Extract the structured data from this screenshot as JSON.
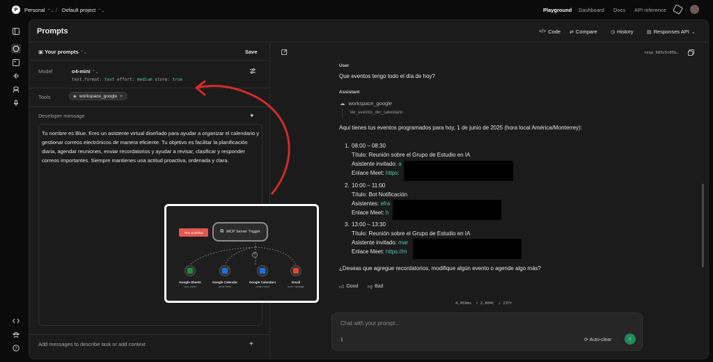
{
  "topbar": {
    "org_initial": "P",
    "org": "Personal",
    "sep": "/",
    "project": "Default project",
    "nav": [
      "Playground",
      "Dashboard",
      "Docs",
      "API reference"
    ]
  },
  "header": {
    "title": "Prompts",
    "code": "Code",
    "compare": "Compare",
    "history": "History",
    "api": "Responses API"
  },
  "left": {
    "your_prompts": "Your prompts",
    "save": "Save",
    "model_label": "Model",
    "model_name": "o4-mini",
    "params": [
      {
        "k": "text.format:",
        "v": "text"
      },
      {
        "k": "effort:",
        "v": "medium"
      },
      {
        "k": "store:",
        "v": "true"
      }
    ],
    "tools_label": "Tools",
    "tool_chip": "workspace_google",
    "dev_label": "Developer message",
    "dev_text": "Tu nombre es Blue. Eres un asistente virtual diseñado para ayudar a organizar el calendario y gestionar correos electrónicos de manera eficiente. Tu objetivo es facilitar la planificación diaria, agendar reuniones, enviar recordatorios y ayudar a revisar, clasificar y responder correos importantes. Siempre mantienes una actitud proactiva, ordenada y clara.",
    "add_messages": "Add messages to describe task or add context",
    "add_plus": "+"
  },
  "workflow": {
    "tag": "Test workflow",
    "trigger": "MCP Server Trigger",
    "nodes": [
      {
        "label": "Google Sheets",
        "sub": "hoot_sheet",
        "color": "#1e8e3e"
      },
      {
        "label": "Google Calendar",
        "sub": "gente event",
        "color": "#1a73e8"
      },
      {
        "label": "Google Calendar1",
        "sub": "create: event",
        "color": "#1a73e8"
      },
      {
        "label": "Gmail",
        "sub": "send: message",
        "color": "#ea4335"
      }
    ]
  },
  "right": {
    "resp_id": "resp_683c5c05b…",
    "user_role": "User",
    "user_msg": "Que eventos tengo todo el día de hoy?",
    "assistant_role": "Assistant",
    "tool_name": "workspace_google",
    "tool_sub": "Ver_eventos_der_calendario",
    "intro": "Aqui tienes tus eventos programados para hoy, 1 de junio de 2025 (hora local América/Monterrey):",
    "events": [
      {
        "num": "1.",
        "time": "08:00 – 08:30",
        "title": "Título: Reunión sobre el Grupo de Estudio en IA",
        "l2": "Asistente invitado: ",
        "l2v": "a",
        "l3": "Enlace Meet: ",
        "l3v": "https:"
      },
      {
        "num": "2.",
        "time": "10:00 – 11:00",
        "title": "Título: Bot Notificación",
        "l2": "Asistentes: ",
        "l2v": "efra",
        "l3": "Enlace Meet: ",
        "l3v": "h"
      },
      {
        "num": "3.",
        "time": "13:00 – 13:30",
        "title": "Título: Reunión sobre el Grupo de Estudio en IA",
        "l2": "Asistente invitado: ",
        "l2v": "mar",
        "l3": "Enlace Meet: ",
        "l3v": "https://m"
      }
    ],
    "question": "¿Deseas que agregue recordatorios, modifique algún evento o agende algo más?",
    "good": "Good",
    "bad": "Bad",
    "metrics": [
      "4,959ms",
      "↑ 2,804t",
      "↓ 237t"
    ],
    "chat_placeholder": "Chat with your prompt...",
    "autoclear": "Auto-clear"
  }
}
